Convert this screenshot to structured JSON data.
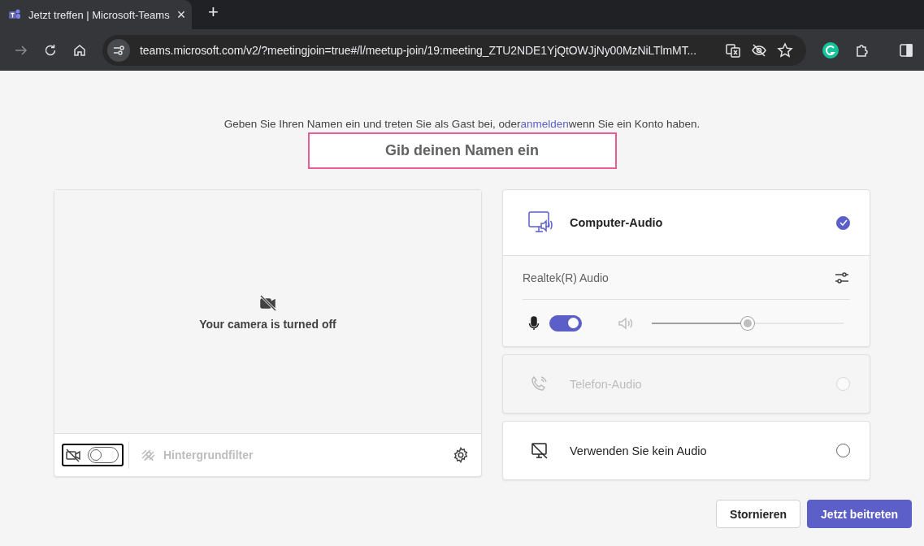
{
  "browser": {
    "tab": {
      "title": "Jetzt treffen | Microsoft-Teams",
      "close": "×"
    },
    "new_tab": "+",
    "url": "teams.microsoft.com/v2/?meetingjoin=true#/l/meetup-join/19:meeting_ZTU2NDE1YjQtOWJjNy00MzNiLTlmMT..."
  },
  "intro": {
    "before": "Geben Sie Ihren Namen ein und treten Sie als Gast bei, oder",
    "link": "anmelden",
    "after": "wenn Sie ein Konto haben."
  },
  "name_field": {
    "placeholder": "Gib deinen Namen ein"
  },
  "camera": {
    "message": "Your camera is turned off",
    "on": false,
    "background_filter": {
      "label": "Hintergrundfilter",
      "disabled": true
    }
  },
  "audio_options": [
    {
      "kind": "computer",
      "label": "Computer-Audio",
      "selected": true,
      "disabled": false,
      "device": {
        "name": "Realtek(R) Audio",
        "mic_on": true,
        "speaker": {
          "level": 0.5
        }
      }
    },
    {
      "kind": "phone",
      "label": "Telefon-Audio",
      "selected": false,
      "disabled": true
    },
    {
      "kind": "none",
      "label": "Verwenden Sie kein Audio",
      "selected": false,
      "disabled": false
    }
  ],
  "buttons": [
    {
      "kind": "secondary",
      "label": "Stornieren"
    },
    {
      "kind": "primary",
      "label": "Jetzt beitreten"
    }
  ]
}
